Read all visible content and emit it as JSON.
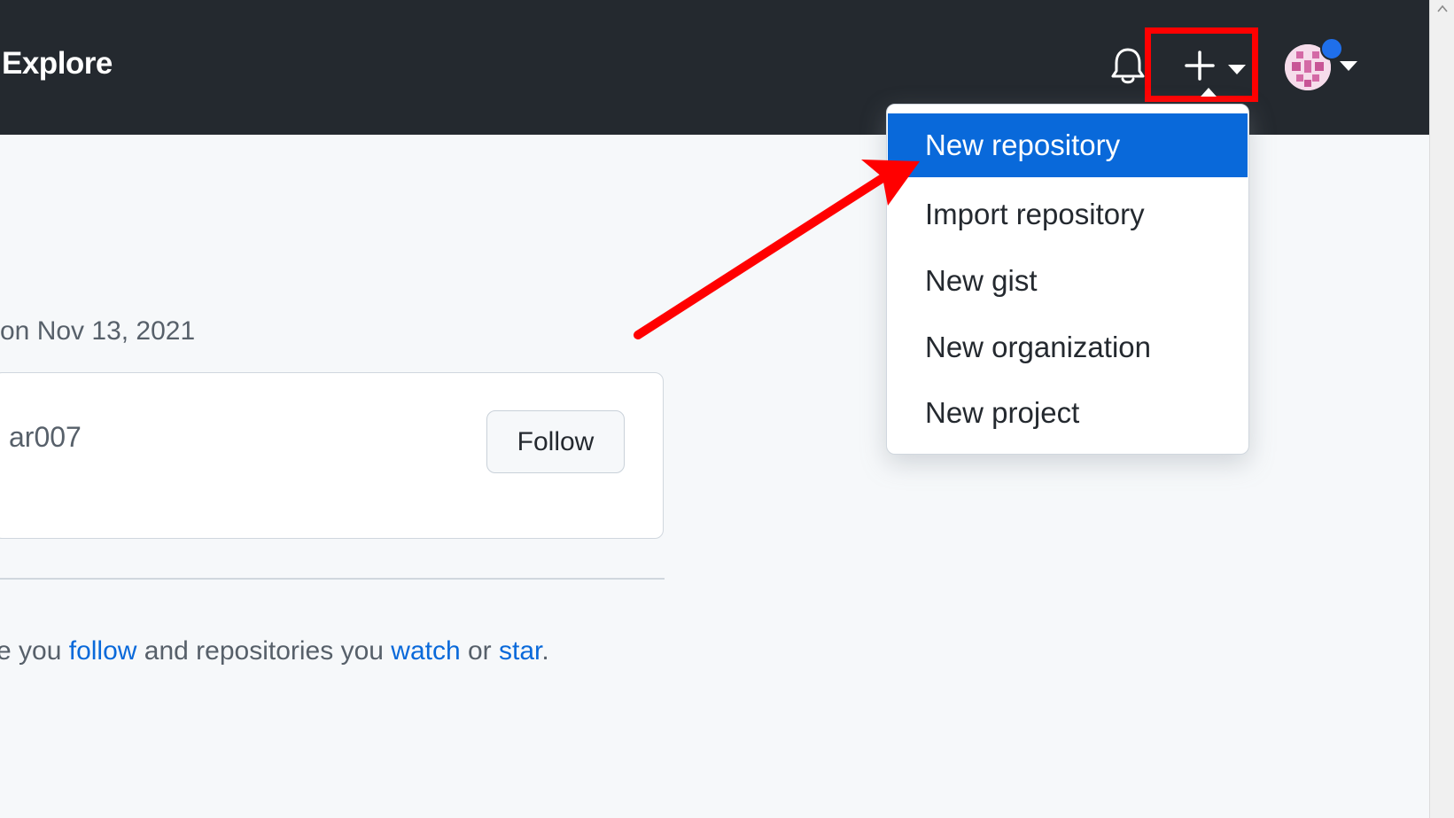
{
  "header": {
    "nav_label": "Explore",
    "icons": [
      "bell-icon",
      "plus-icon",
      "caret-down-icon",
      "avatar"
    ]
  },
  "dropdown": {
    "items": [
      {
        "label": "New repository"
      },
      {
        "label": "Import repository"
      },
      {
        "label": "New gist"
      },
      {
        "label": "New organization"
      },
      {
        "label": "New project"
      }
    ]
  },
  "content": {
    "joined_text": "on Nov 13, 2021",
    "username": "ar007",
    "follow_label": "Follow",
    "info": {
      "prefix": "e you ",
      "follow_link": "follow",
      "middle": " and repositories you ",
      "watch_link": "watch",
      "or_text": " or ",
      "star_link": "star",
      "suffix": "."
    }
  },
  "colors": {
    "header_bg": "#24292f",
    "accent_blue": "#0969da",
    "annotation_red": "#ff0000"
  }
}
